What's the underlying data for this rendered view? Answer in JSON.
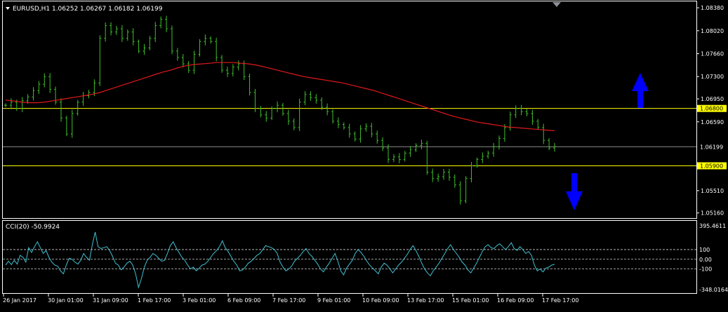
{
  "window": {
    "symbol_info": "EURUSD,H1  1.06252 1.06267 1.06182 1.06199",
    "menu_arrow_icon": "triangle-down-icon"
  },
  "colors": {
    "background": "#000000",
    "candles": "#3fbf2a",
    "moving_average": "#e01919",
    "level": "#ffff00",
    "current_price_line": "#8c8c8c",
    "cci": "#40c0d0",
    "arrows": "#0000ff",
    "axis_text": "#ffffff",
    "frame": "#ffffff"
  },
  "chart_data": [
    {
      "type": "candlestick",
      "title": "EURUSD,H1",
      "ohlc_last": {
        "open": 1.06252,
        "high": 1.06267,
        "low": 1.06182,
        "close": 1.06199
      },
      "ylim": [
        1.0508,
        1.0848
      ],
      "y_ticks": [
        "1.08380",
        "1.08020",
        "1.07660",
        "1.07300",
        "1.06950",
        "1.06590",
        "1.05510",
        "1.05160"
      ],
      "x_labels": [
        "26 Jan 2017",
        "30 Jan 01:00",
        "31 Jan 09:00",
        "1 Feb 17:00",
        "3 Feb 01:00",
        "6 Feb 09:00",
        "7 Feb 17:00",
        "9 Feb 01:00",
        "10 Feb 09:00",
        "13 Feb 17:00",
        "15 Feb 01:00",
        "16 Feb 09:00",
        "17 Feb 17:00"
      ],
      "close_series": [
        1.0685,
        1.069,
        1.068,
        1.0692,
        1.0698,
        1.0708,
        1.0718,
        1.073,
        1.071,
        1.069,
        1.0665,
        1.064,
        1.0672,
        1.069,
        1.07,
        1.0705,
        1.072,
        1.079,
        1.081,
        1.08,
        1.0805,
        1.079,
        1.08,
        1.0785,
        1.077,
        1.0775,
        1.079,
        1.081,
        1.082,
        1.0805,
        1.077,
        1.076,
        1.075,
        1.074,
        1.0765,
        1.0785,
        1.079,
        1.0785,
        1.076,
        1.074,
        1.0735,
        1.0745,
        1.075,
        1.073,
        1.0705,
        1.068,
        1.067,
        1.0665,
        1.068,
        1.0685,
        1.0672,
        1.066,
        1.065,
        1.069,
        1.0702,
        1.0697,
        1.0693,
        1.0682,
        1.0675,
        1.066,
        1.0655,
        1.065,
        1.064,
        1.0632,
        1.0648,
        1.0652,
        1.064,
        1.063,
        1.0618,
        1.06,
        1.0604,
        1.06,
        1.061,
        1.0615,
        1.0622,
        1.0625,
        1.058,
        1.057,
        1.0573,
        1.058,
        1.0572,
        1.056,
        1.0535,
        1.057,
        1.059,
        1.06,
        1.0605,
        1.061,
        1.062,
        1.0633,
        1.065,
        1.067,
        1.068,
        1.0675,
        1.0672,
        1.066,
        1.065,
        1.063,
        1.0618,
        1.062
      ],
      "series": [
        {
          "name": "MA",
          "values": [
            1.0693,
            1.0692,
            1.069,
            1.0689,
            1.0689,
            1.069,
            1.0692,
            1.0694,
            1.0696,
            1.0698,
            1.07,
            1.0702,
            1.0705,
            1.0709,
            1.0713,
            1.0717,
            1.0721,
            1.0725,
            1.0729,
            1.0733,
            1.0737,
            1.074,
            1.0744,
            1.0747,
            1.0749,
            1.075,
            1.0751,
            1.0752,
            1.0752,
            1.0752,
            1.0751,
            1.075,
            1.0748,
            1.0745,
            1.0742,
            1.0739,
            1.0736,
            1.0733,
            1.073,
            1.0728,
            1.0726,
            1.0724,
            1.0722,
            1.072,
            1.0717,
            1.0714,
            1.0711,
            1.0708,
            1.0704,
            1.07,
            1.0696,
            1.0692,
            1.0688,
            1.0684,
            1.068,
            1.0676,
            1.0672,
            1.0668,
            1.0665,
            1.0662,
            1.0659,
            1.0657,
            1.0655,
            1.0653,
            1.0651,
            1.065,
            1.0649,
            1.0648,
            1.0647,
            1.0646,
            1.0645
          ]
        }
      ],
      "levels": [
        {
          "label": "1.06800",
          "value": 1.068,
          "color": "yellow"
        },
        {
          "label": "1.05900",
          "value": 1.059,
          "color": "yellow"
        },
        {
          "label": "1.06199",
          "value": 1.06199,
          "color": "gray"
        }
      ],
      "annotations": [
        {
          "type": "arrow-up",
          "color": "blue",
          "near": "1.06950"
        },
        {
          "type": "arrow-down",
          "color": "blue",
          "near": "1.05510"
        }
      ]
    },
    {
      "type": "line",
      "title": "CCI(20) -50.9924",
      "y_ticks": [
        "395.4611",
        "100",
        "0.00",
        "-100",
        "-348.0164"
      ],
      "ylim": [
        -348.0164,
        395.4611
      ],
      "reference_lines": [
        100,
        0,
        -100
      ],
      "values": [
        -60,
        -20,
        -55,
        -10,
        -50,
        40,
        20,
        -30,
        120,
        70,
        130,
        180,
        120,
        60,
        90,
        20,
        -30,
        -60,
        -70,
        -120,
        -150,
        -60,
        10,
        0,
        -30,
        -50,
        -10,
        60,
        20,
        -10,
        150,
        280,
        130,
        110,
        120,
        130,
        90,
        30,
        -40,
        -60,
        -110,
        -80,
        -40,
        -20,
        -60,
        -150,
        -290,
        -200,
        -80,
        -10,
        20,
        60,
        40,
        10,
        -20,
        -10,
        60,
        140,
        180,
        120,
        70,
        20,
        -10,
        -60,
        -100,
        -80,
        -120,
        -90,
        -60,
        -50,
        -20,
        20,
        60,
        90,
        130,
        190,
        120,
        80,
        30,
        -20,
        -60,
        -120,
        -110,
        -80,
        -40,
        -20,
        10,
        40,
        60,
        100,
        140,
        130,
        120,
        100,
        60,
        -30,
        -80,
        -120,
        -100,
        -70,
        -20,
        10,
        40,
        80,
        110,
        60,
        30,
        -10,
        -50,
        -100,
        -130,
        -80,
        -40,
        10,
        60,
        -20,
        -120,
        -160,
        -90,
        -50,
        -10,
        60,
        100,
        70,
        30,
        -20,
        -60,
        -90,
        -120,
        -150,
        -80,
        -40,
        -60,
        -100,
        -140,
        -100,
        -60,
        -30,
        10,
        50,
        100,
        140,
        90,
        30,
        -40,
        -100,
        -140,
        -170,
        -120,
        -80,
        -40,
        10,
        60,
        110,
        150,
        100,
        60,
        20,
        -30,
        -60,
        -110,
        -140,
        -90,
        -40,
        20,
        80,
        130,
        150,
        120,
        110,
        140,
        160,
        130,
        100,
        130,
        170,
        110,
        90,
        130,
        100,
        60,
        80,
        40,
        -60,
        -120,
        -100,
        -130,
        -90,
        -80,
        -60,
        -51
      ]
    }
  ]
}
